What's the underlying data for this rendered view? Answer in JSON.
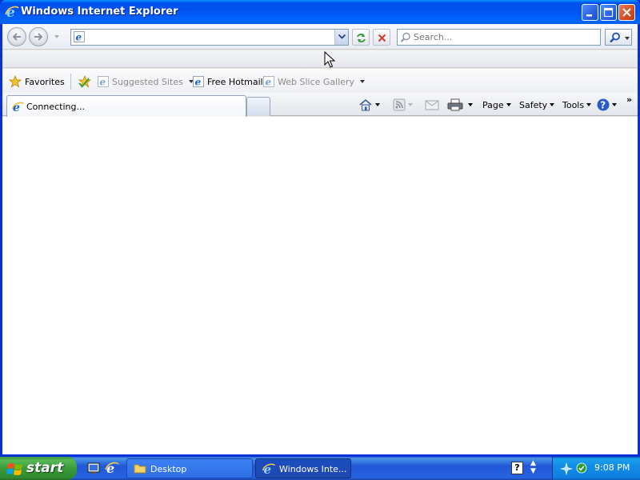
{
  "window": {
    "title": "Windows Internet Explorer"
  },
  "address": {
    "value": ""
  },
  "search": {
    "placeholder": "Search..."
  },
  "favorites": {
    "favorites_label": "Favorites",
    "items": [
      {
        "label": "Suggested Sites",
        "enabled": false
      },
      {
        "label": "Free Hotmail",
        "enabled": true
      },
      {
        "label": "Web Slice Gallery",
        "enabled": false
      }
    ]
  },
  "tabs": [
    {
      "label": "Connecting..."
    }
  ],
  "commandbar": {
    "page_label": "Page",
    "safety_label": "Safety",
    "tools_label": "Tools",
    "overflow": "»"
  },
  "taskbar": {
    "start_label": "start",
    "tasks": [
      {
        "label": "Desktop",
        "active": false
      },
      {
        "label": "Windows Inte...",
        "active": true
      }
    ],
    "help_glyph": "?",
    "clock": "9:08 PM"
  },
  "icons": {
    "title": "ie-logo-icon",
    "back": "back-arrow-icon",
    "forward": "forward-arrow-icon",
    "refresh": "refresh-icon",
    "stop": "stop-icon",
    "search": "magnifier-icon",
    "home": "home-icon",
    "feeds": "rss-feed-icon",
    "mail": "read-mail-icon",
    "print": "printer-icon",
    "help": "help-icon"
  },
  "colors": {
    "titlebar": "#0053ee",
    "start_button": "#3a9a3a",
    "taskbar": "#2157d7",
    "tray": "#118de6",
    "close_button": "#d44c21"
  }
}
